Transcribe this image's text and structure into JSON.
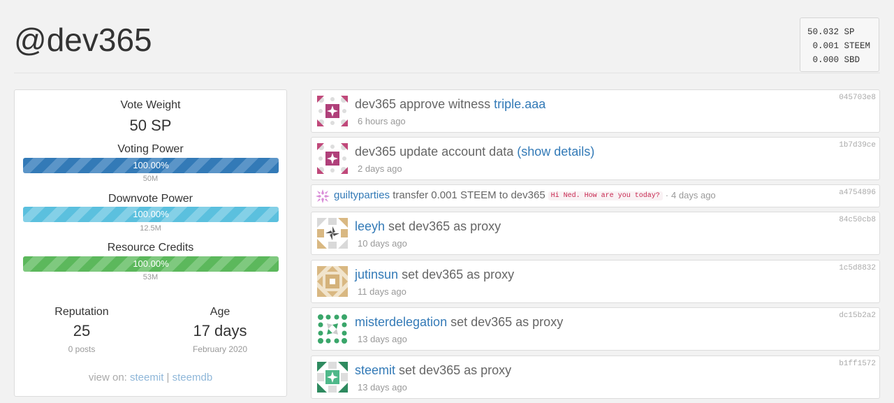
{
  "account": {
    "title": "@dev365"
  },
  "balances": [
    {
      "amount": "50.032",
      "unit": "SP"
    },
    {
      "amount": " 0.001",
      "unit": "STEEM"
    },
    {
      "amount": " 0.000",
      "unit": "SBD"
    }
  ],
  "stats": {
    "vote_weight_label": "Vote Weight",
    "vote_weight_value": "50 SP",
    "voting_power_label": "Voting Power",
    "voting_power_pct": "100.00%",
    "voting_power_sub": "50M",
    "downvote_power_label": "Downvote Power",
    "downvote_power_pct": "100.00%",
    "downvote_power_sub": "12.5M",
    "resource_credits_label": "Resource Credits",
    "resource_credits_pct": "100.00%",
    "resource_credits_sub": "53M",
    "reputation_label": "Reputation",
    "reputation_value": "25",
    "reputation_sub": "0 posts",
    "age_label": "Age",
    "age_value": "17 days",
    "age_sub": "February 2020",
    "view_on_label": "view on:",
    "view_on_steemit": "steemit",
    "view_on_sep": "|",
    "view_on_steemdb": "steemdb"
  },
  "feed": [
    {
      "actor": "dev365",
      "action": "approve witness",
      "target": "triple.aaa",
      "time": "6 hours ago",
      "id": "045703e8"
    },
    {
      "actor": "dev365",
      "action": "update account data",
      "target": "(show details)",
      "time": "2 days ago",
      "id": "1b7d39ce"
    },
    {
      "actor": "guiltyparties",
      "action": "transfer 0.001 STEEM to dev365",
      "memo": "Hi Ned. How are you today?",
      "sep": "·",
      "time": "4 days ago",
      "id": "a4754896"
    },
    {
      "actor": "leeyh",
      "action": "set dev365 as proxy",
      "time": "10 days ago",
      "id": "84c50cb8"
    },
    {
      "actor": "jutinsun",
      "action": "set dev365 as proxy",
      "time": "11 days ago",
      "id": "1c5d8832"
    },
    {
      "actor": "misterdelegation",
      "action": "set dev365 as proxy",
      "time": "13 days ago",
      "id": "dc15b2a2"
    },
    {
      "actor": "steemit",
      "action": "set dev365 as proxy",
      "time": "13 days ago",
      "id": "b1ff1572"
    }
  ],
  "colors": {
    "link": "#337ab7",
    "voting_bar": "#337ab7",
    "downvote_bar": "#5bc0de",
    "rc_bar": "#5cb85c"
  }
}
